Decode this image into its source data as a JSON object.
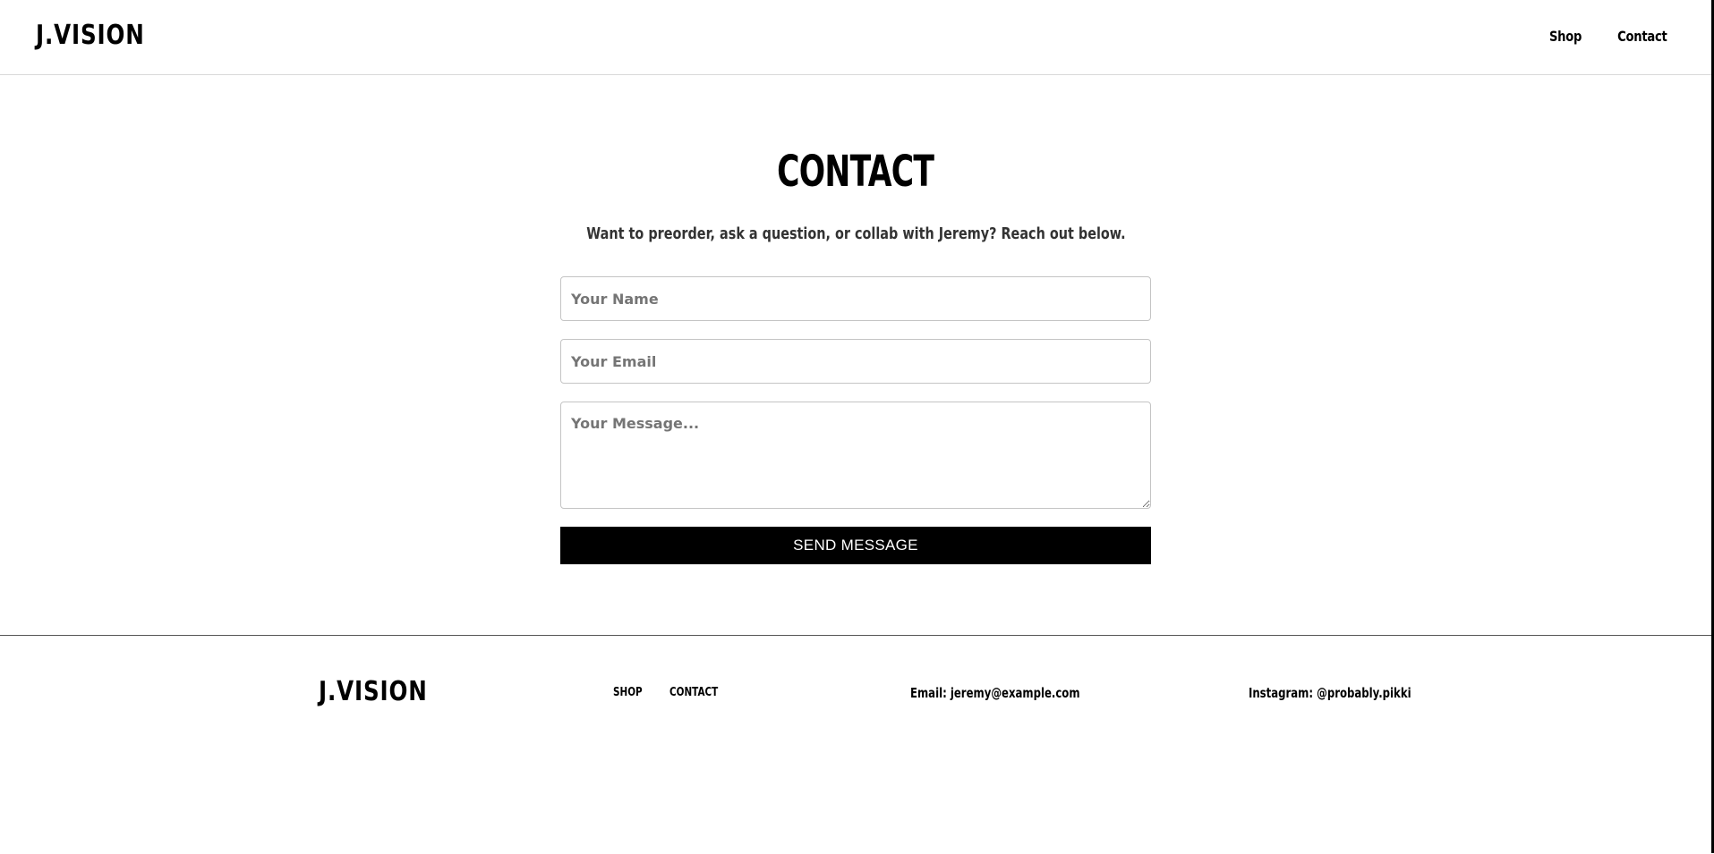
{
  "header": {
    "logo": "J.VISION",
    "nav": [
      {
        "label": "Shop"
      },
      {
        "label": "Contact"
      }
    ]
  },
  "main": {
    "title": "CONTACT",
    "subtitle": "Want to preorder, ask a question, or collab with Jeremy? Reach out below.",
    "form": {
      "name_placeholder": "Your Name",
      "email_placeholder": "Your Email",
      "message_placeholder": "Your Message...",
      "submit_label": "SEND MESSAGE"
    }
  },
  "footer": {
    "logo": "J.VISION",
    "links": [
      {
        "label": "SHOP"
      },
      {
        "label": "CONTACT"
      }
    ],
    "email": "Email: jeremy@example.com",
    "instagram": "Instagram: @probably.pikki"
  },
  "colors": {
    "background": "#ffffff",
    "text": "#000000",
    "button": "#000000",
    "button_text": "#ffffff"
  }
}
